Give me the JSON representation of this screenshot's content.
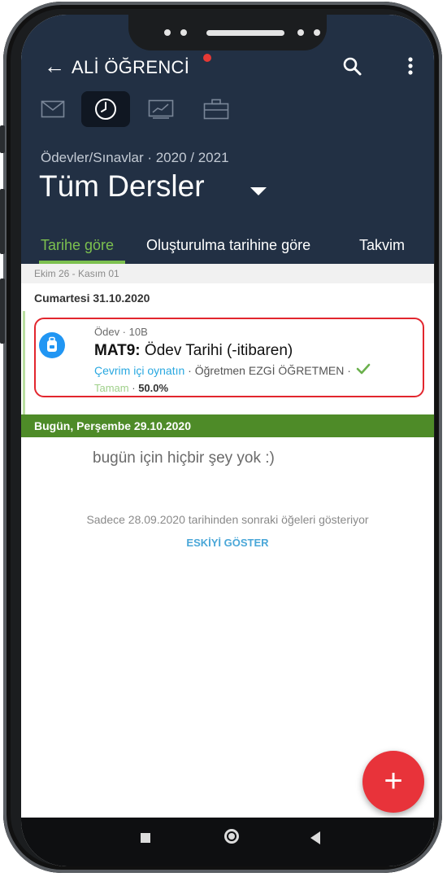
{
  "app_bar": {
    "back_glyph": "←",
    "title": "ALİ ÖĞRENCİ",
    "notification_color": "#e53935",
    "search_icon": "search-icon",
    "more_icon": "more-vert-icon"
  },
  "nav_icons": [
    {
      "name": "mail-icon",
      "active": false
    },
    {
      "name": "clock-icon",
      "active": true
    },
    {
      "name": "chart-icon",
      "active": false
    },
    {
      "name": "briefcase-icon",
      "active": false
    }
  ],
  "header": {
    "subtitle": "Ödevler/Sınavlar · 2020 / 2021",
    "title": "Tüm Dersler"
  },
  "tabs": [
    {
      "label": "Tarihe göre",
      "active": true
    },
    {
      "label": "Oluşturulma tarihine göre",
      "active": false
    },
    {
      "label": "Takvim",
      "active": false
    }
  ],
  "list": {
    "range_label": "Ekim 26 - Kasım 01",
    "day_label": "Cumartesi 31.10.2020",
    "item": {
      "meta": "Ödev · 10B",
      "course": "MAT9:",
      "title": " Ödev Tarihi (-itibaren)",
      "link": "Çevrim içi oynatın",
      "separator": " · ",
      "teacher": "Öğretmen EZGİ ÖĞRETMEN ·",
      "status": "Tamam",
      "status_sep": " · ",
      "progress": "50.0%"
    },
    "today_label": "Bugün, Perşembe 29.10.2020",
    "empty_message": "bugün için hiçbir şey yok :)",
    "footnote": "Sadece 28.09.2020 tarihinden sonraki öğeleri gösteriyor",
    "show_old": "ESKİYİ GÖSTER"
  },
  "fab": {
    "label": "+"
  },
  "colors": {
    "header_bg": "#223044",
    "accent_green": "#7cc04f",
    "today_bar": "#4e8b28",
    "fab": "#e8333a",
    "link": "#29a8e0"
  }
}
